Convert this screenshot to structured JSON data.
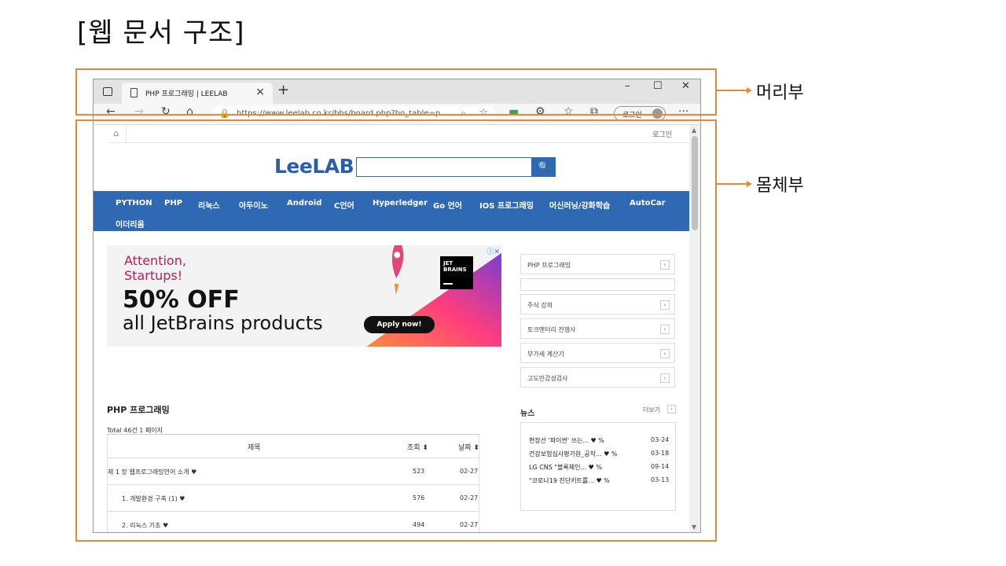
{
  "slide": {
    "title": "[웹 문서 구조]"
  },
  "browser": {
    "tab_title": "PHP 프로그래밍 | LEELAB",
    "tab_close": "×",
    "new_tab": "+",
    "window_controls": {
      "minimize": "–",
      "maximize": "☐",
      "close": "✕"
    },
    "url": "https://www.leelab.co.kr/bbs/board.php?bo_table=p...",
    "profile_button": "로그인",
    "more": "···",
    "icons": [
      "sidebar-toggle-icon",
      "document-icon",
      "back-icon",
      "forward-icon",
      "refresh-icon",
      "home-icon",
      "lock-icon",
      "zoom-icon",
      "favorite-add-icon",
      "extension-icon",
      "gear-icon",
      "favorites-icon",
      "collections-icon",
      "avatar-icon"
    ]
  },
  "site": {
    "login_link": "로그인",
    "logo": "LeeLAB",
    "search_icon": "🔍",
    "nav": [
      "PYTHON",
      "PHP",
      "리눅스",
      "아두이노",
      "Android",
      "C언어",
      "Hyperledger",
      "Go 언어",
      "IOS 프로그래밍",
      "머신러닝/강화학습",
      "AutoCar",
      "이더리움"
    ],
    "ad": {
      "headline": "Attention,\nStartups!",
      "offer": "50% OFF",
      "products": "all JetBrains products",
      "cta": "Apply now!",
      "brand": "JET\nBRAINS",
      "colors": {
        "accent": "#c2185b",
        "gradient_start": "#ff6b6b",
        "gradient_end": "#7b3fd1"
      }
    },
    "sidebar": [
      {
        "label": "PHP 프로그래밍"
      },
      {
        "label": ""
      },
      {
        "label": "주식 강의"
      },
      {
        "label": "토크멘터리 전쟁사"
      },
      {
        "label": "부가세 계산기"
      },
      {
        "label": "고도민감성검사"
      }
    ],
    "board": {
      "title": "PHP 프로그래밍",
      "total": "Total 46건 1 페이지",
      "columns": [
        "제목",
        "조회 ⬍",
        "날짜 ⬍"
      ],
      "rows": [
        {
          "title": "제 1 장 웹프로그래밍언어 소개 ♥",
          "views": "523",
          "date": "02-27"
        },
        {
          "title": "1. 개발환경 구축 (1) ♥",
          "views": "576",
          "date": "02-27"
        },
        {
          "title": "2. 리눅스 기초 ♥",
          "views": "494",
          "date": "02-27"
        }
      ]
    },
    "news": {
      "title": "뉴스",
      "more": "더보기",
      "items": [
        {
          "title": "현장선 '파이썬' 쓰는... ♥ %",
          "date": "03-24"
        },
        {
          "title": "건강보험심사평가원_공작... ♥ %",
          "date": "03-18"
        },
        {
          "title": "LG CNS \"블록체인... ♥ %",
          "date": "09-14"
        },
        {
          "title": "\"코로나19 진단키트를... ♥ %",
          "date": "03-13"
        }
      ]
    }
  },
  "callouts": {
    "header": "머리부",
    "body": "몸체부"
  },
  "colors": {
    "frame": "#e8873a",
    "nav": "#2f69b3",
    "logo": "#2b5ea8"
  }
}
